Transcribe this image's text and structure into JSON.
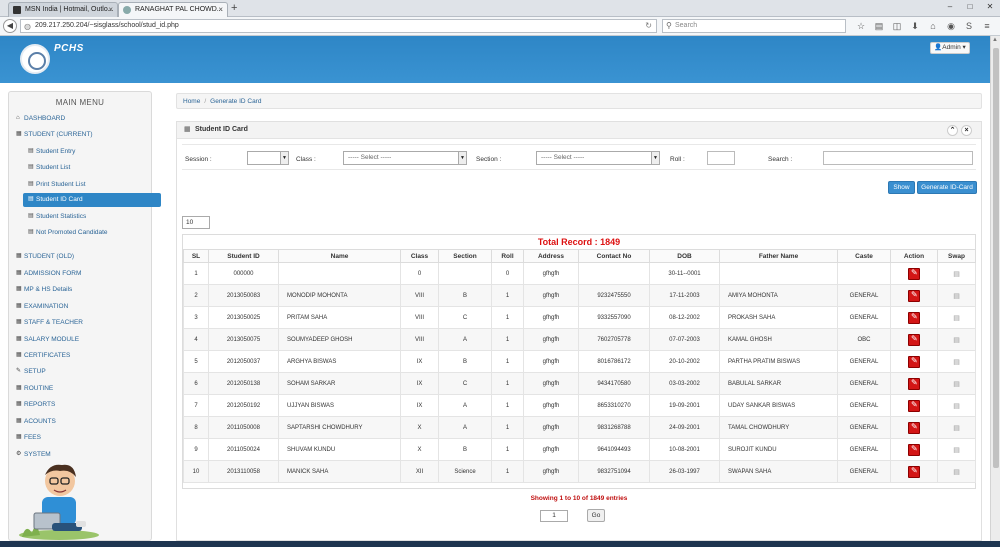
{
  "browser": {
    "tabs": [
      {
        "label": "MSN India | Hotmail, Outlo..."
      },
      {
        "label": "RANAGHAT PAL CHOWD..."
      }
    ],
    "url": "209.217.250.204/~sisglass/school/stud_id.php",
    "search_placeholder": "Search"
  },
  "header": {
    "brand": "PCHS",
    "admin_label": "Admin"
  },
  "sidebar": {
    "title": "MAIN MENU",
    "items": [
      {
        "label": "DASHBOARD",
        "icon": "home-icon"
      },
      {
        "label": "STUDENT (CURRENT)",
        "icon": "grid-icon"
      },
      {
        "label": "Student Entry",
        "icon": "list-icon"
      },
      {
        "label": "Student List",
        "icon": "list-icon"
      },
      {
        "label": "Print Student List",
        "icon": "list-icon"
      },
      {
        "label": "Student ID Card",
        "icon": "list-icon"
      },
      {
        "label": "Student Statistics",
        "icon": "list-icon"
      },
      {
        "label": "Not Promoted Candidate",
        "icon": "list-icon"
      },
      {
        "label": "STUDENT (OLD)",
        "icon": "grid-icon"
      },
      {
        "label": "ADMISSION FORM",
        "icon": "grid-icon"
      },
      {
        "label": "MP & HS Details",
        "icon": "grid-icon"
      },
      {
        "label": "EXAMINATION",
        "icon": "grid-icon"
      },
      {
        "label": "STAFF & TEACHER",
        "icon": "grid-icon"
      },
      {
        "label": "SALARY MODULE",
        "icon": "grid-icon"
      },
      {
        "label": "CERTIFICATES",
        "icon": "grid-icon"
      },
      {
        "label": "SETUP",
        "icon": "wrench-icon"
      },
      {
        "label": "ROUTINE",
        "icon": "grid-icon"
      },
      {
        "label": "REPORTS",
        "icon": "grid-icon"
      },
      {
        "label": "ACOUNTS",
        "icon": "grid-icon"
      },
      {
        "label": "FEES",
        "icon": "grid-icon"
      },
      {
        "label": "SYSTEM",
        "icon": "gears-icon"
      }
    ]
  },
  "breadcrumb": {
    "home": "Home",
    "current": "Generate ID Card"
  },
  "panel": {
    "title": "Student ID Card",
    "filters": {
      "session_label": "Session :",
      "class_label": "Class :",
      "class_value": "----- Select -----",
      "section_label": "Section :",
      "section_value": "----- Select -----",
      "roll_label": "Roll :",
      "search_label": "Search :"
    },
    "show_button": "Show",
    "generate_button": "Generate ID-Card",
    "page_length": "10",
    "total_record": "Total Record : 1849",
    "columns": [
      "SL",
      "Student ID",
      "Name",
      "Class",
      "Section",
      "Roll",
      "Address",
      "Contact No",
      "DOB",
      "Father Name",
      "Caste",
      "Action",
      "Swap"
    ],
    "rows": [
      [
        "1",
        "000000",
        "",
        "0",
        "",
        "0",
        "gfhgfh",
        "",
        "30-11--0001",
        "",
        ""
      ],
      [
        "2",
        "2013050083",
        "MONODIP MOHONTA",
        "VIII",
        "B",
        "1",
        "gfhgfh",
        "9232475550",
        "17-11-2003",
        "AMIYA MOHONTA",
        "GENERAL"
      ],
      [
        "3",
        "2013050025",
        "PRITAM SAHA",
        "VIII",
        "C",
        "1",
        "gfhgfh",
        "9332557090",
        "08-12-2002",
        "PROKASH SAHA",
        "GENERAL"
      ],
      [
        "4",
        "2013050075",
        "SOUMYADEEP GHOSH",
        "VIII",
        "A",
        "1",
        "gfhgfh",
        "7602705778",
        "07-07-2003",
        "KAMAL GHOSH",
        "OBC"
      ],
      [
        "5",
        "2012050037",
        "ARGHYA BISWAS",
        "IX",
        "B",
        "1",
        "gfhgfh",
        "8016786172",
        "20-10-2002",
        "PARTHA PRATIM BISWAS",
        "GENERAL"
      ],
      [
        "6",
        "2012050138",
        "SOHAM SARKAR",
        "IX",
        "C",
        "1",
        "gfhgfh",
        "9434170580",
        "03-03-2002",
        "BABULAL SARKAR",
        "GENERAL"
      ],
      [
        "7",
        "2012050192",
        "UJJYAN BISWAS",
        "IX",
        "A",
        "1",
        "gfhgfh",
        "8653310270",
        "19-09-2001",
        "UDAY SANKAR BISWAS",
        "GENERAL"
      ],
      [
        "8",
        "2011050008",
        "SAPTARSHI CHOWDHURY",
        "X",
        "A",
        "1",
        "gfhgfh",
        "9831268788",
        "24-09-2001",
        "TAMAL CHOWDHURY",
        "GENERAL"
      ],
      [
        "9",
        "2011050024",
        "SHUVAM KUNDU",
        "X",
        "B",
        "1",
        "gfhgfh",
        "9641094493",
        "10-08-2001",
        "SUROJIT KUNDU",
        "GENERAL"
      ],
      [
        "10",
        "2013110058",
        "MANICK SAHA",
        "XII",
        "Science",
        "1",
        "gfhgfh",
        "9832751094",
        "26-03-1997",
        "SWAPAN SAHA",
        "GENERAL"
      ]
    ],
    "showing": "Showing 1 to 10 of 1849 entries",
    "page_value": "1",
    "go_button": "Go"
  },
  "colors": {
    "accent": "#2e86c6",
    "danger": "#d31515"
  }
}
